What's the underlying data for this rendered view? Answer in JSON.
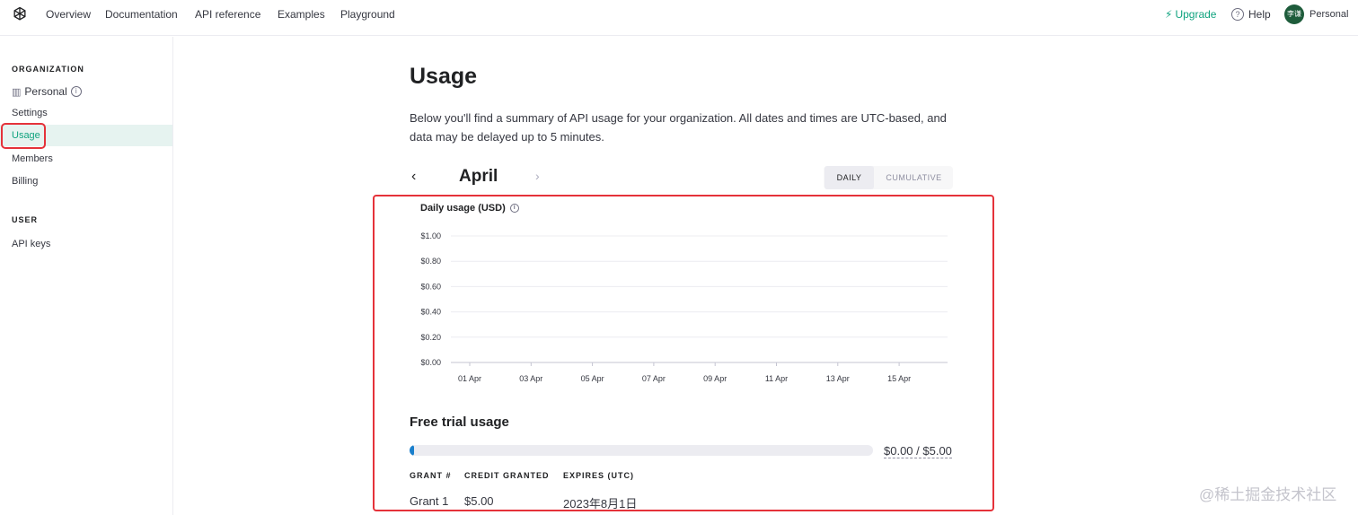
{
  "nav": {
    "links": [
      "Overview",
      "Documentation",
      "API reference",
      "Examples",
      "Playground"
    ],
    "upgrade": "Upgrade",
    "help": "Help",
    "avatar_text": "李谦",
    "account": "Personal"
  },
  "sidebar": {
    "organization_label": "ORGANIZATION",
    "org_name": "Personal",
    "items": [
      "Settings",
      "Usage",
      "Members",
      "Billing"
    ],
    "active_item": "Usage",
    "user_label": "USER",
    "user_items": [
      "API keys"
    ]
  },
  "main": {
    "title": "Usage",
    "description": "Below you'll find a summary of API usage for your organization. All dates and times are UTC-based, and data may be delayed up to 5 minutes.",
    "month": "April",
    "toggle": {
      "daily": "DAILY",
      "cumulative": "CUMULATIVE",
      "selected": "DAILY"
    }
  },
  "chart_data": {
    "type": "line",
    "title": "Daily usage (USD)",
    "xlabel": "",
    "ylabel": "",
    "x": [
      "01 Apr",
      "03 Apr",
      "05 Apr",
      "07 Apr",
      "09 Apr",
      "11 Apr",
      "13 Apr",
      "15 Apr"
    ],
    "y_ticks": [
      "$0.00",
      "$0.20",
      "$0.40",
      "$0.60",
      "$0.80",
      "$1.00"
    ],
    "ylim": [
      0,
      1
    ],
    "series": [],
    "grid": true
  },
  "trial": {
    "title": "Free trial usage",
    "used": 0.0,
    "limit": 5.0,
    "amount_label": "$0.00 / $5.00",
    "headers": [
      "GRANT #",
      "CREDIT GRANTED",
      "EXPIRES (UTC)"
    ],
    "rows": [
      [
        "Grant 1",
        "$5.00",
        "2023年8月1日"
      ]
    ]
  },
  "watermark": "@稀土掘金技术社区",
  "colors": {
    "accent": "#10a37f",
    "highlight": "#e5323a",
    "bar": "#1a7fcc"
  }
}
